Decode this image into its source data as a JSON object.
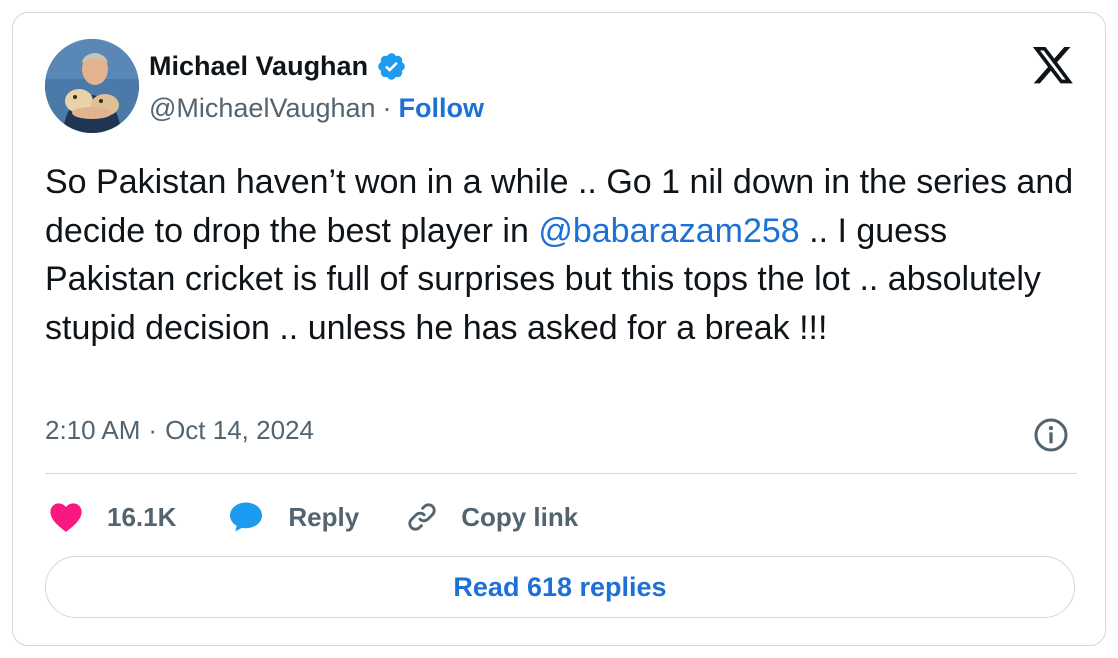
{
  "author": {
    "name": "Michael Vaughan",
    "handle": "@MichaelVaughan",
    "separator": "·",
    "follow_label": "Follow"
  },
  "tweet": {
    "text_part1": "So Pakistan haven’t won in a while .. Go 1 nil down in the series and decide to drop the best player in ",
    "mention": "@babarazam258",
    "text_part2": " .. I guess Pakistan cricket is full of surprises but this tops the lot .. absolutely stupid decision .. unless he has asked for a break !!!",
    "time": "2:10 AM",
    "separator": "·",
    "date": "Oct 14, 2024"
  },
  "actions": {
    "like_count": "16.1K",
    "reply_label": "Reply",
    "copy_link_label": "Copy link"
  },
  "read_replies_label": "Read 618 replies",
  "icons": {
    "verified": "verified-badge-icon",
    "platform": "x-logo-icon",
    "info": "info-icon",
    "like": "heart-icon",
    "reply": "speech-bubble-icon",
    "copy": "link-icon"
  },
  "colors": {
    "link_blue": "#1d70d6",
    "verified_blue": "#1d9bf0",
    "heart_pink": "#f91880",
    "secondary_text": "#536471",
    "primary_text": "#0f1419",
    "border": "#cfd9de"
  }
}
